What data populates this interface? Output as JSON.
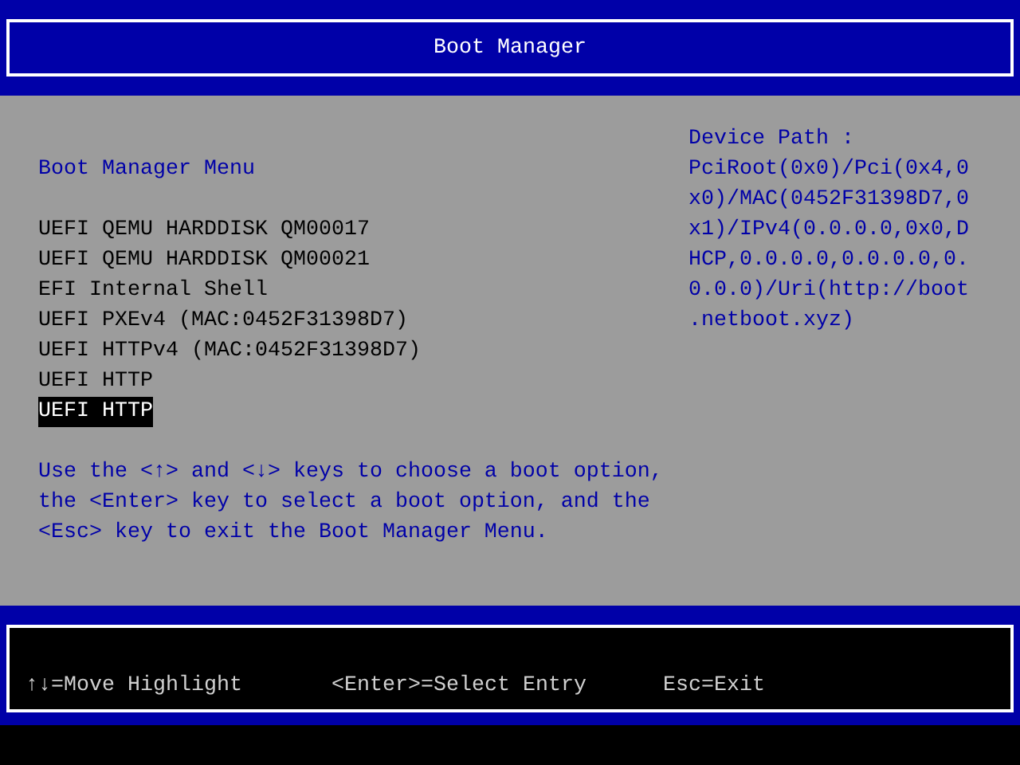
{
  "window": {
    "title": "Boot Manager"
  },
  "menu": {
    "heading": "Boot Manager Menu",
    "items": [
      {
        "label": "UEFI QEMU HARDDISK QM00017",
        "selected": false
      },
      {
        "label": "UEFI QEMU HARDDISK QM00021",
        "selected": false
      },
      {
        "label": "EFI Internal Shell",
        "selected": false
      },
      {
        "label": "UEFI PXEv4 (MAC:0452F31398D7)",
        "selected": false
      },
      {
        "label": "UEFI HTTPv4 (MAC:0452F31398D7)",
        "selected": false
      },
      {
        "label": "UEFI HTTP",
        "selected": false
      },
      {
        "label": "UEFI HTTP",
        "selected": true
      }
    ],
    "help": [
      "Use the <↑> and <↓> keys to choose a boot option,",
      "the <Enter> key to select a boot option, and the",
      "<Esc> key to exit the Boot Manager Menu."
    ]
  },
  "device_path": {
    "heading": "Device Path :",
    "lines": [
      "PciRoot(0x0)/Pci(0x4,0",
      "x0)/MAC(0452F31398D7,0",
      "x1)/IPv4(0.0.0.0,0x0,D",
      "HCP,0.0.0.0,0.0.0.0,0.",
      "0.0.0)/Uri(http://boot",
      ".netboot.xyz)"
    ]
  },
  "status_bar": [
    "↑↓=Move Highlight",
    "<Enter>=Select Entry",
    "Esc=Exit"
  ]
}
